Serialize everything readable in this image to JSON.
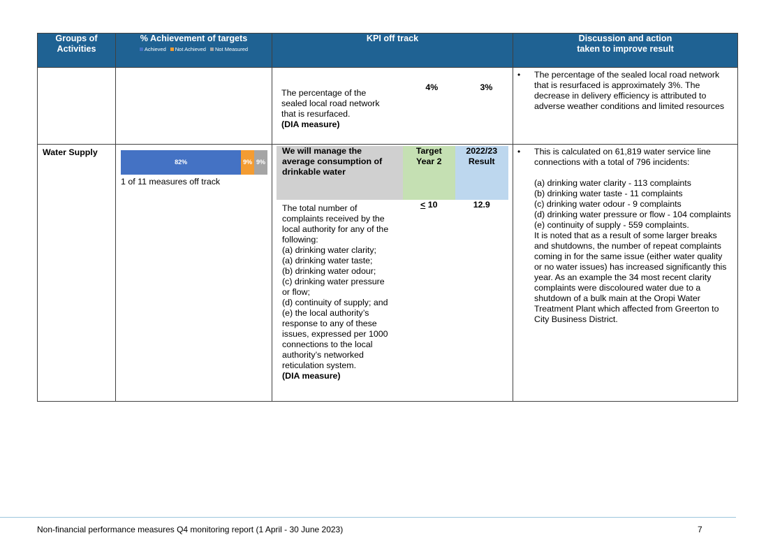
{
  "header": {
    "groups": "Groups of Activities",
    "achievement": "% Achievement of targets",
    "legend": [
      {
        "label": "Achieved",
        "color": "#4472c4"
      },
      {
        "label": "Not Achieved",
        "color": "#f39c32"
      },
      {
        "label": "Not Measured",
        "color": "#a5a5a5"
      }
    ],
    "kpi": "KPI off track",
    "discussion": "Discussion and action taken to improve result"
  },
  "row1": {
    "kpi_desc": "The percentage of the sealed local road network that is resurfaced.",
    "kpi_dia": "(DIA measure)",
    "target": "4%",
    "result": "3%",
    "discussion": "The percentage of the sealed local road network that is resurfaced is approximately 3%. The decrease in delivery efficiency is attributed to adverse weather conditions and limited resources"
  },
  "row2": {
    "group": "Water Supply",
    "bar": [
      {
        "label": "82%",
        "value": 82,
        "color": "#4472c4"
      },
      {
        "label": "9%",
        "value": 9,
        "color": "#f39c32"
      },
      {
        "label": "9%",
        "value": 9,
        "color": "#a5a5a5"
      }
    ],
    "off_track": "1 of 11 measures off track",
    "kpi_heading": "We will manage the average consumption of drinkable water",
    "target_heading": "Target Year 2",
    "result_heading": "2022/23 Result",
    "kpi_desc_lines": [
      "The total number of",
      "complaints received by the",
      "local authority for any of the",
      "following:",
      "(a) drinking water clarity;",
      "(a) drinking water taste;",
      "(b) drinking water odour;",
      "(c) drinking water pressure",
      "or flow;",
      "(d) continuity of supply; and",
      "(e) the local authority’s",
      "response to any of these",
      "issues, expressed per 1000",
      "connections to the local",
      "authority’s networked",
      "reticulation system."
    ],
    "kpi_dia": "(DIA measure)",
    "target": "< 10",
    "result": "12.9",
    "discussion_lines": [
      "This is calculated on 61,819 water service line connections with a total of 796 incidents:",
      "",
      "(a) drinking water clarity - 113 complaints",
      "(b) drinking water taste - 11 complaints",
      "(c) drinking water odour - 9 complaints",
      "(d) drinking water pressure or flow - 104 complaints",
      "(e) continuity of supply - 559 complaints.",
      "It is noted that as a result of some larger breaks and shutdowns, the number of repeat complaints coming in for the same issue (either water quality or no water issues) has increased significantly this year. As an example the 34 most recent clarity complaints were discoloured water due to a shutdown of a bulk main at the Oropi Water Treatment Plant which affected from Greerton to City Business District."
    ]
  },
  "footer": {
    "text": "Non-financial performance measures Q4 monitoring report (1 April - 30 June 2023)",
    "page": "7"
  }
}
